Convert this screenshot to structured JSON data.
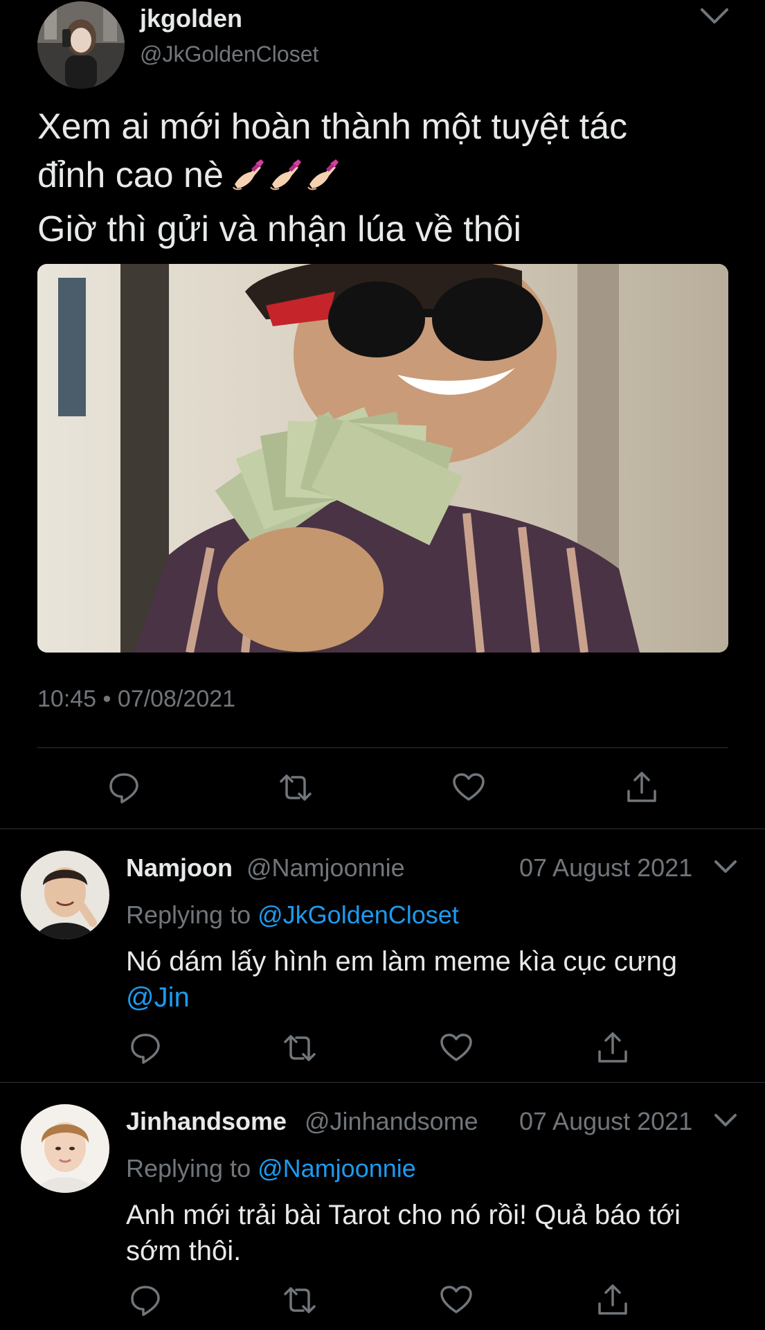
{
  "main_tweet": {
    "name": "jkgolden",
    "handle": "@JkGoldenCloset",
    "text_line1": "Xem ai mới hoàn thành một tuyệt tác",
    "text_line2": "đỉnh cao nè",
    "text_line2_emoji": [
      "nail-polish-emoji",
      "nail-polish-emoji",
      "nail-polish-emoji"
    ],
    "text_line3": "Giờ thì gửi và nhận lúa về thôi",
    "timestamp": "10:45 • 07/08/2021",
    "image_subject": "person in sunglasses holding fanned dollar bills"
  },
  "actions": [
    "reply-icon",
    "retweet-icon",
    "like-icon",
    "share-icon"
  ],
  "replies": [
    {
      "name": "Namjoon",
      "handle": "@Namjoonnie",
      "date": "07 August 2021",
      "replying_prefix": "Replying to",
      "replying_to": "@JkGoldenCloset",
      "text": "Nó dám lấy hình em làm meme kìa cục cưng",
      "mention": "@Jin"
    },
    {
      "name": "Jinhandsome",
      "handle": "@Jinhandsome",
      "date": "07 August 2021",
      "replying_prefix": "Replying to",
      "replying_to": "@Namjoonnie",
      "text_line1": "Anh mới trải bài Tarot cho nó rồi! Quả báo tới",
      "text_line2": "sớm thôi."
    }
  ],
  "colors": {
    "background": "#000000",
    "primary_text": "#e7e9ea",
    "secondary_text": "#71767b",
    "link": "#1d9bf0",
    "divider": "#2f3336"
  }
}
